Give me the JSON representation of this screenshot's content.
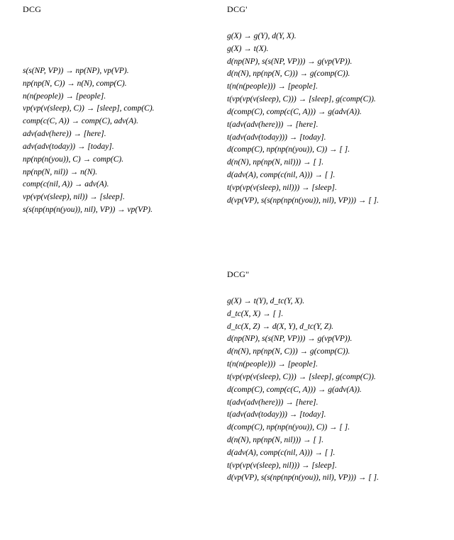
{
  "dcg": {
    "heading": "DCG",
    "rules": [
      "s(s(NP, VP)) → np(NP), vp(VP).",
      "np(np(N, C)) → n(N), comp(C).",
      "n(n(people)) → [people].",
      "vp(vp(v(sleep), C)) → [sleep], comp(C).",
      "comp(c(C, A)) → comp(C), adv(A).",
      "adv(adv(here)) → [here].",
      "adv(adv(today)) → [today].",
      "np(np(n(you)), C) → comp(C).",
      "np(np(N, nil)) → n(N).",
      "comp(c(nil, A)) → adv(A).",
      "vp(vp(v(sleep), nil)) → [sleep].",
      "s(s(np(np(n(you)), nil), VP)) → vp(VP)."
    ]
  },
  "dcgp": {
    "heading": "DCG'",
    "rules": [
      "g(X) → g(Y), d(Y, X).",
      "g(X) → t(X).",
      "d(np(NP), s(s(NP, VP))) → g(vp(VP)).",
      "d(n(N), np(np(N, C))) → g(comp(C)).",
      "t(n(n(people))) → [people].",
      "t(vp(vp(v(sleep), C))) → [sleep], g(comp(C)).",
      "d(comp(C), comp(c(C, A))) → g(adv(A)).",
      "t(adv(adv(here))) → [here].",
      "t(adv(adv(today))) → [today].",
      "d(comp(C), np(np(n(you)), C)) → [ ].",
      "d(n(N), np(np(N, nil))) → [ ].",
      "d(adv(A), comp(c(nil, A))) → [ ].",
      "t(vp(vp(v(sleep), nil))) → [sleep].",
      "d(vp(VP), s(s(np(np(n(you)), nil), VP))) → [ ]."
    ]
  },
  "dcgpp": {
    "heading": "DCG''",
    "rules": [
      "g(X) → t(Y), d_tc(Y, X).",
      "d_tc(X, X) → [ ].",
      "d_tc(X, Z) → d(X, Y), d_tc(Y, Z).",
      "d(np(NP), s(s(NP, VP))) → g(vp(VP)).",
      "d(n(N), np(np(N, C))) → g(comp(C)).",
      "t(n(n(people))) → [people].",
      "t(vp(vp(v(sleep), C))) → [sleep], g(comp(C)).",
      "d(comp(C), comp(c(C, A))) → g(adv(A)).",
      "t(adv(adv(here))) → [here].",
      "t(adv(adv(today))) → [today].",
      "d(comp(C), np(np(n(you)), C)) → [ ].",
      "d(n(N), np(np(N, nil))) → [ ].",
      "d(adv(A), comp(c(nil, A))) → [ ].",
      "t(vp(vp(v(sleep), nil))) → [sleep].",
      "d(vp(VP), s(s(np(np(n(you)), nil), VP))) → [ ]."
    ]
  }
}
